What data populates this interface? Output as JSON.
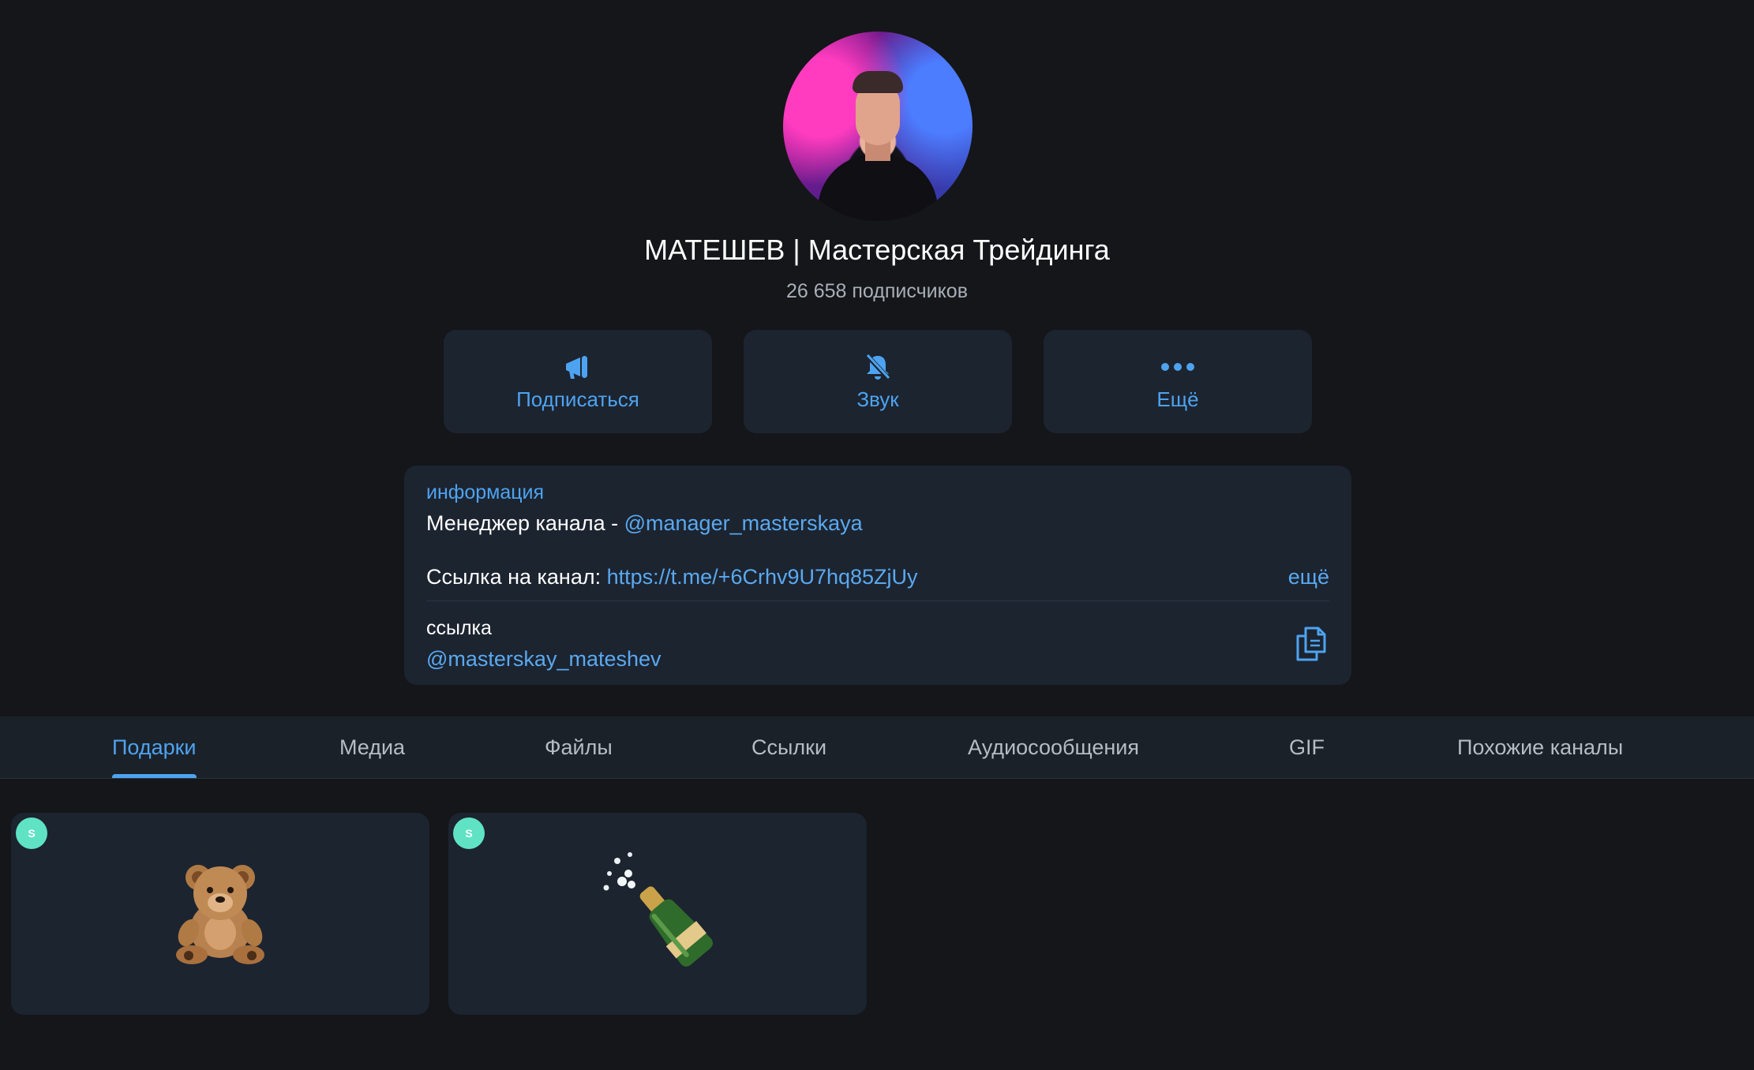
{
  "channel": {
    "title": "МАТЕШЕВ | Мастерская Трейдинга",
    "subscribers": "26 658 подписчиков",
    "avatar_icon": "profile-photo"
  },
  "actions": [
    {
      "label": "Подписаться",
      "icon": "megaphone-icon"
    },
    {
      "label": "Звук",
      "icon": "bell-off-icon"
    },
    {
      "label": "Ещё",
      "icon": "more-dots-icon"
    }
  ],
  "info": {
    "heading": "информация",
    "manager_prefix": "Менеджер канала - ",
    "manager_link": "@manager_masterskaya",
    "channel_link_prefix": "Ссылка на канал: ",
    "channel_link": "https://t.me/+6Crhv9U7hq85ZjUy",
    "more_label": "ещё",
    "link_label": "ссылка",
    "username": "@masterskay_mateshev",
    "copy_icon": "copy-icon"
  },
  "tabs": [
    {
      "label": "Подарки",
      "active": true
    },
    {
      "label": "Медиа"
    },
    {
      "label": "Файлы"
    },
    {
      "label": "Ссылки"
    },
    {
      "label": "Аудиосообщения"
    },
    {
      "label": "GIF"
    },
    {
      "label": "Похожие каналы"
    }
  ],
  "gifts": [
    {
      "badge": "S",
      "icon": "teddy-bear-icon"
    },
    {
      "badge": "S",
      "icon": "champagne-bottle-icon"
    }
  ],
  "colors": {
    "background": "#141619",
    "card": "#1c2430",
    "accent": "#4ea3f0",
    "muted_text": "#a9afb8",
    "badge": "#5fe3c4"
  }
}
